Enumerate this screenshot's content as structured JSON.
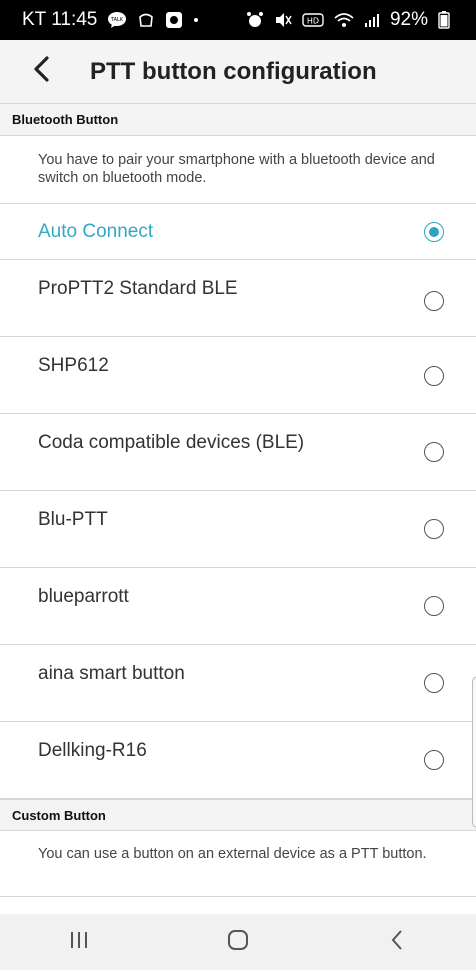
{
  "status_bar": {
    "carrier_time": "KT 11:45",
    "battery": "92%"
  },
  "app_bar": {
    "title": "PTT button configuration"
  },
  "bluetooth_section": {
    "header": "Bluetooth Button",
    "description": "You have to pair your smartphone with a bluetooth device and switch on bluetooth mode.",
    "options": [
      {
        "label": "Auto Connect",
        "selected": true
      },
      {
        "label": "ProPTT2 Standard BLE",
        "selected": false
      },
      {
        "label": "SHP612",
        "selected": false
      },
      {
        "label": "Coda compatible devices (BLE)",
        "selected": false
      },
      {
        "label": "Blu-PTT",
        "selected": false
      },
      {
        "label": "blueparrott",
        "selected": false
      },
      {
        "label": "aina smart button",
        "selected": false
      },
      {
        "label": "Dellking-R16",
        "selected": false
      }
    ]
  },
  "custom_section": {
    "header": "Custom Button",
    "description": "You can use a button on an external device as a PTT button."
  },
  "colors": {
    "accent": "#2aa4c2",
    "status_bar": "#000000",
    "app_bar": "#f4f4f4"
  }
}
